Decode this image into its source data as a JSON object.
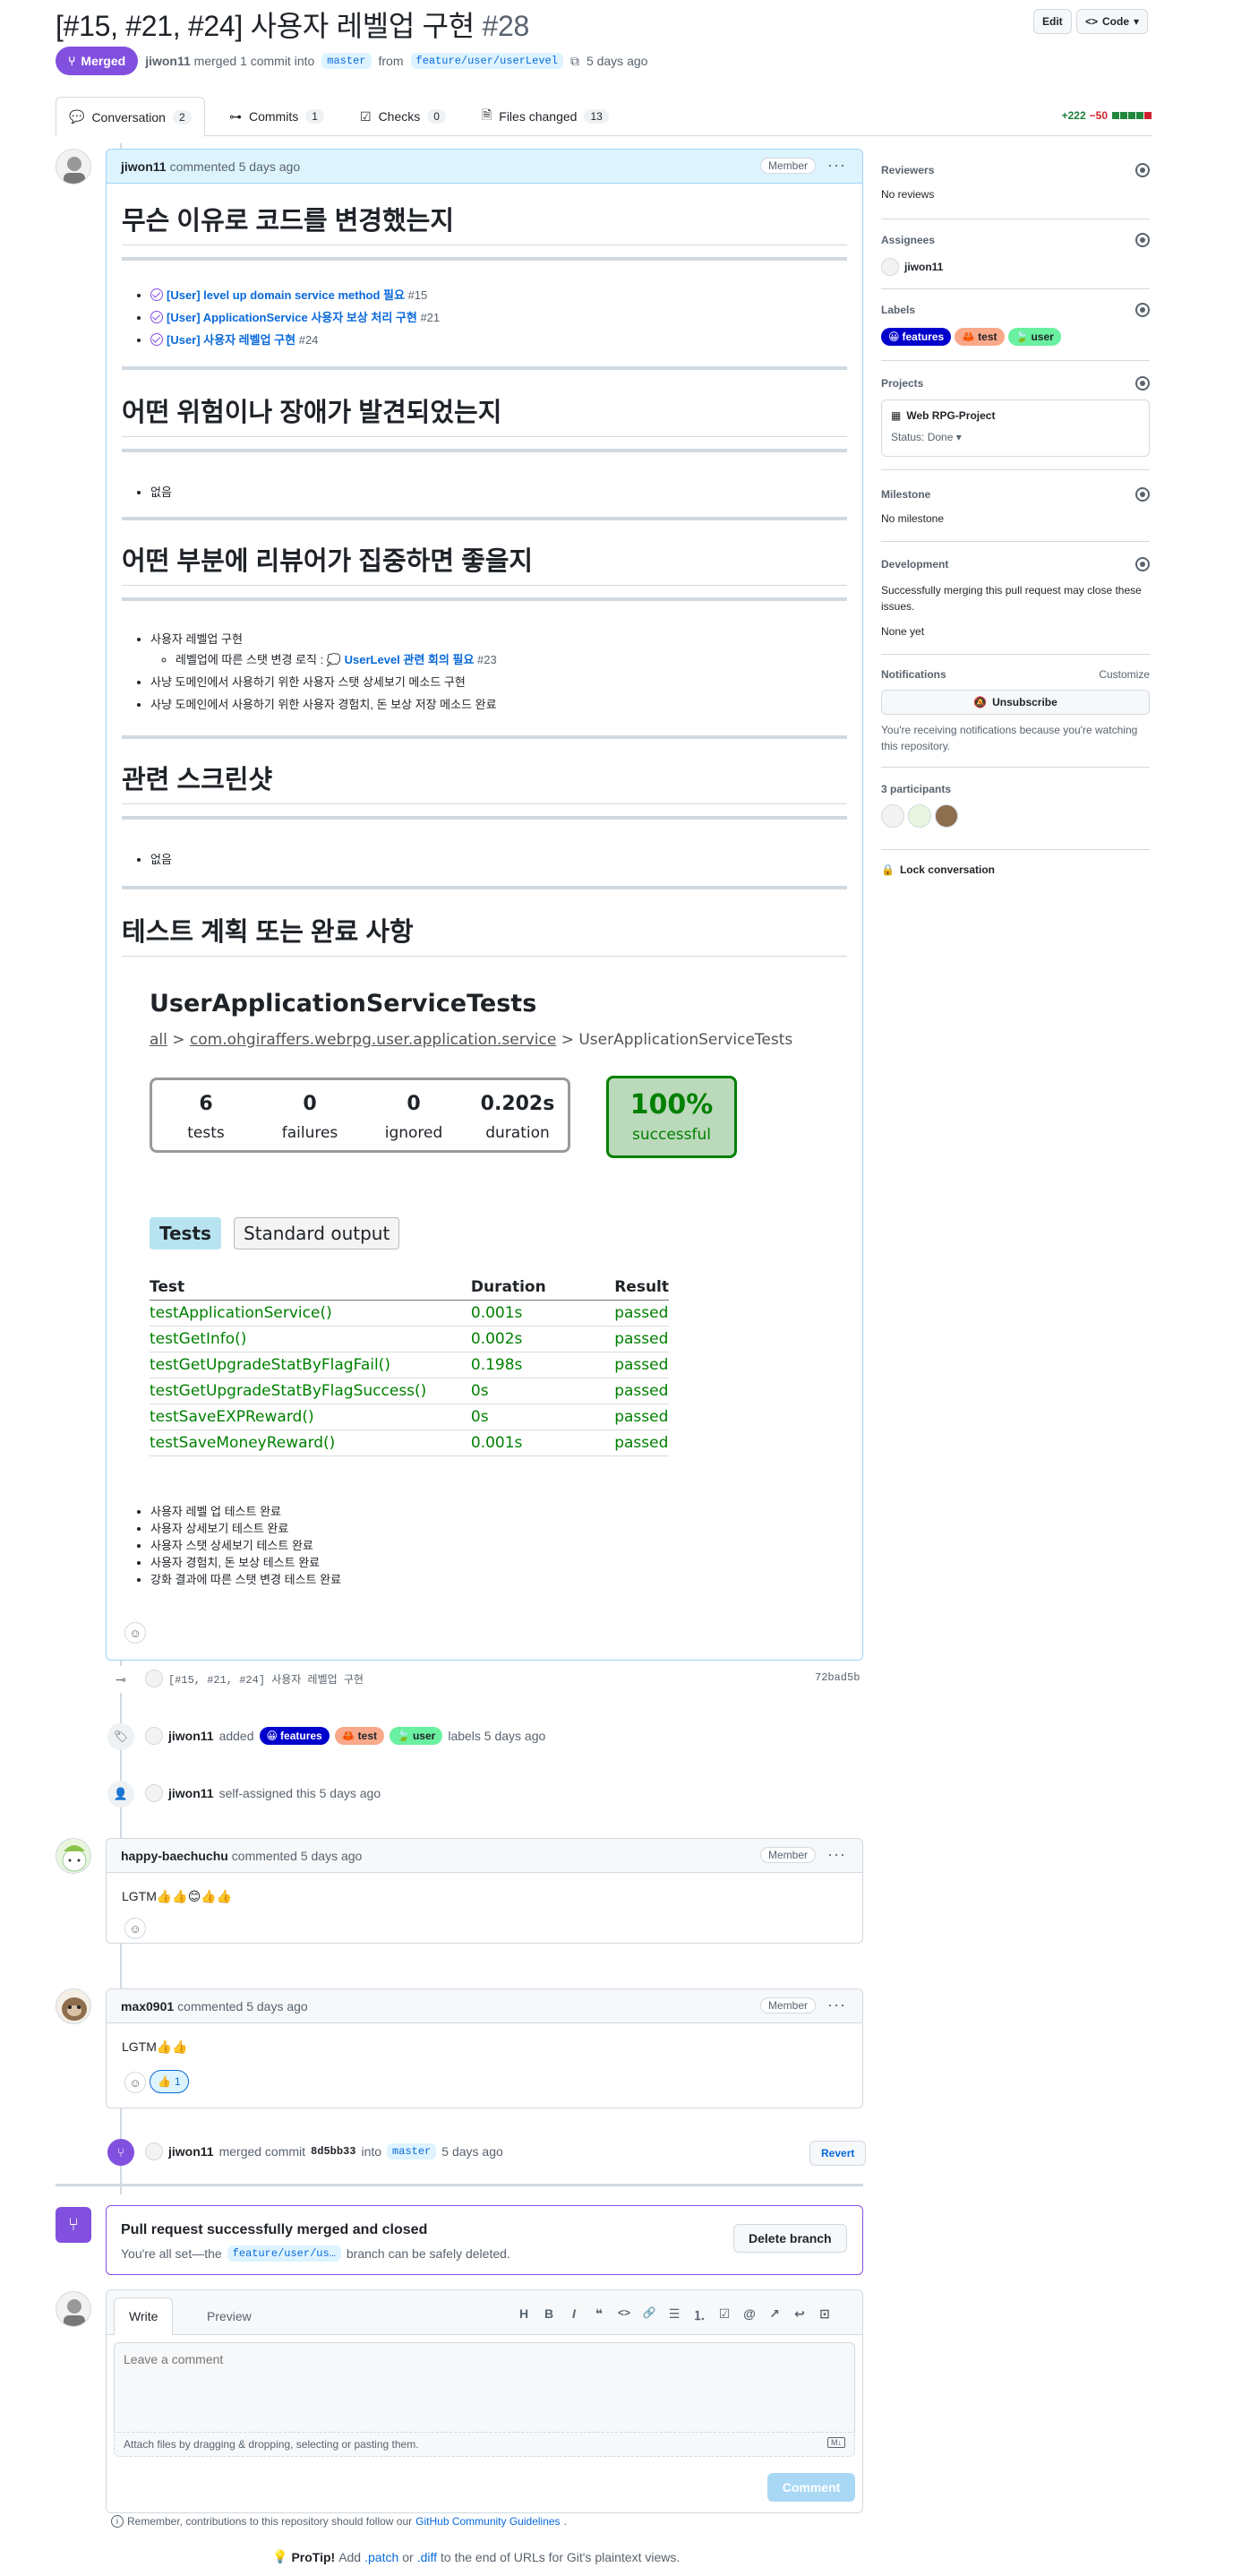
{
  "header": {
    "title": "[#15, #21, #24] 사용자 레벨업 구현",
    "number": "#28",
    "edit_label": "Edit",
    "code_label": "Code",
    "status_label": "Merged",
    "author": "jiwon11",
    "merge_text": "merged 1 commit into",
    "base_branch": "master",
    "from_text": "from",
    "head_branch": "feature/user/userLevel",
    "time": "5 days ago"
  },
  "tabs": [
    {
      "label": "Conversation",
      "count": "2"
    },
    {
      "label": "Commits",
      "count": "1"
    },
    {
      "label": "Checks",
      "count": "0"
    },
    {
      "label": "Files changed",
      "count": "13"
    }
  ],
  "diffstat": {
    "additions": "+222",
    "deletions": "−50"
  },
  "main_comment": {
    "author": "jiwon11",
    "action": "commented 5 days ago",
    "role": "Member",
    "h_reason": "무슨 이유로 코드를 변경했는지",
    "refs": [
      {
        "title": "[User] level up domain service method 필요",
        "num": "#15"
      },
      {
        "title": "[User] ApplicationService 사용자 보상 처리 구현",
        "num": "#21"
      },
      {
        "title": "[User] 사용자 레벨업 구현",
        "num": "#24"
      }
    ],
    "h_risk": "어떤 위험이나 장애가 발견되었는지",
    "risk_items": [
      "없음"
    ],
    "h_focus": "어떤 부분에 리뷰어가 집중하면 좋을지",
    "focus_item1": "사용자 레벨업 구현",
    "focus_sub_prefix": "레벨업에 따른 스탯 변경 로직 :",
    "focus_sub_link": "UserLevel 관련 회의 필요",
    "focus_sub_num": "#23",
    "focus_item2": "사냥 도메인에서 사용하기 위한 사용자 스탯 상세보기 메소드 구현",
    "focus_item3": "사냥 도메인에서 사용하기 위한 사용자 경험치, 돈 보상 저장 메소드 완료",
    "h_shots": "관련 스크린샷",
    "shot_items": [
      "없음"
    ],
    "h_test": "테스트 계획 또는 완료 사항",
    "test_items": [
      "사용자 레벨 업 테스트 완료",
      "사용자 상세보기 테스트 완료",
      "사용자 스탯 상세보기 테스트 완료",
      "사용자 경험치, 돈 보상 테스트 완료",
      "강화 결과에 따른 스탯 변경 테스트 완료"
    ]
  },
  "report": {
    "title": "UserApplicationServiceTests",
    "crumb_all": "all",
    "crumb_pkg": "com.ohgiraffers.webrpg.user.application.service",
    "crumb_cls": "UserApplicationServiceTests",
    "sep": ">",
    "stats": [
      {
        "value": "6",
        "label": "tests"
      },
      {
        "value": "0",
        "label": "failures"
      },
      {
        "value": "0",
        "label": "ignored"
      },
      {
        "value": "0.202s",
        "label": "duration"
      }
    ],
    "success_value": "100%",
    "success_label": "successful",
    "tab_tests": "Tests",
    "tab_output": "Standard output",
    "columns": [
      "Test",
      "Duration",
      "Result"
    ],
    "rows": [
      [
        "testApplicationService()",
        "0.001s",
        "passed"
      ],
      [
        "testGetInfo()",
        "0.002s",
        "passed"
      ],
      [
        "testGetUpgradeStatByFlagFail()",
        "0.198s",
        "passed"
      ],
      [
        "testGetUpgradeStatByFlagSuccess()",
        "0s",
        "passed"
      ],
      [
        "testSaveEXPReward()",
        "0s",
        "passed"
      ],
      [
        "testSaveMoneyReward()",
        "0.001s",
        "passed"
      ]
    ]
  },
  "events": {
    "commit_msg": "[#15, #21, #24] 사용자 레벨업 구현",
    "commit_sha": "72bad5b",
    "label_actor": "jiwon11",
    "label_added": "added",
    "label_suffix": "labels 5 days ago",
    "assign_actor": "jiwon11",
    "assign_text": "self-assigned this 5 days ago",
    "merge_actor": "jiwon11",
    "merge_text": "merged commit",
    "merge_sha": "8d5bb33",
    "merge_into": "into",
    "merge_branch": "master",
    "merge_time": "5 days ago",
    "revert_label": "Revert"
  },
  "labels": [
    {
      "name": "features",
      "emoji": "😀"
    },
    {
      "name": "test",
      "emoji": "🦀"
    },
    {
      "name": "user",
      "emoji": "🍃"
    }
  ],
  "comment2": {
    "author": "happy-baechuchu",
    "action": "commented 5 days ago",
    "role": "Member",
    "body": "LGTM👍👍😊👍👍"
  },
  "comment3": {
    "author": "max0901",
    "action": "commented 5 days ago",
    "role": "Member",
    "body": "LGTM👍👍",
    "reaction_emoji": "👍",
    "reaction_count": "1"
  },
  "merged_box": {
    "title": "Pull request successfully merged and closed",
    "text_pre": "You're all set—the",
    "branch": "feature/user/us…",
    "text_post": "branch can be safely deleted.",
    "delete_label": "Delete branch"
  },
  "editor": {
    "tab_write": "Write",
    "tab_preview": "Preview",
    "placeholder": "Leave a comment",
    "attach_hint": "Attach files by dragging & dropping, selecting or pasting them.",
    "submit_label": "Comment",
    "toolbar": [
      "H",
      "B",
      "I",
      "❝",
      "<>",
      "🔗",
      "☰",
      "⒈",
      "☑",
      "@",
      "↗",
      "↩",
      "⊡"
    ]
  },
  "footer": {
    "note_pre": "Remember, contributions to this repository should follow our",
    "note_link": "GitHub Community Guidelines",
    "note_post": ".",
    "protip_label": "ProTip!",
    "protip_pre": "Add",
    "protip_patch": ".patch",
    "protip_or": "or",
    "protip_diff": ".diff",
    "protip_post": "to the end of URLs for Git's plaintext views."
  },
  "sidebar": {
    "reviewers_h": "Reviewers",
    "reviewers_v": "No reviews",
    "assignees_h": "Assignees",
    "assignees_v": "jiwon11",
    "labels_h": "Labels",
    "projects_h": "Projects",
    "project_name": "Web RPG-Project",
    "project_status": "Status: Done",
    "milestone_h": "Milestone",
    "milestone_v": "No milestone",
    "dev_h": "Development",
    "dev_text": "Successfully merging this pull request may close these issues.",
    "dev_none": "None yet",
    "notif_h": "Notifications",
    "notif_customize": "Customize",
    "notif_btn": "Unsubscribe",
    "notif_text": "You're receiving notifications because you're watching this repository.",
    "participants_h": "3 participants",
    "lock_label": "Lock conversation"
  }
}
